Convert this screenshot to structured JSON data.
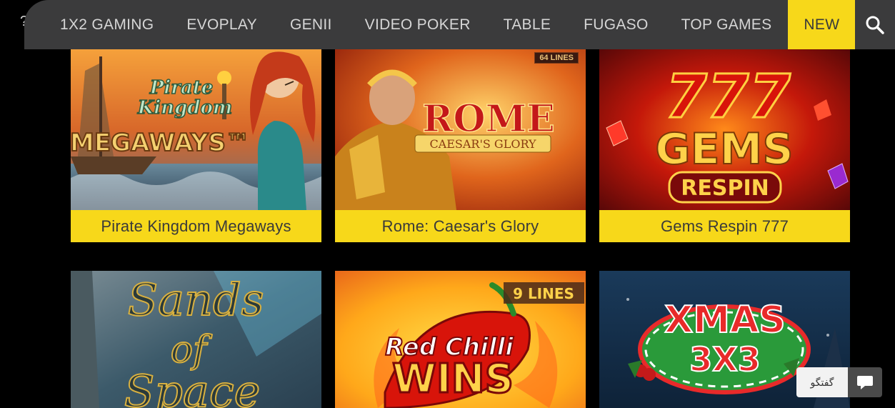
{
  "nav": {
    "items": [
      {
        "label": "1X2 GAMING",
        "active": false
      },
      {
        "label": "EVOPLAY",
        "active": false
      },
      {
        "label": "GENII",
        "active": false
      },
      {
        "label": "VIDEO POKER",
        "active": false
      },
      {
        "label": "TABLE",
        "active": false
      },
      {
        "label": "FUGASO",
        "active": false
      },
      {
        "label": "TOP GAMES",
        "active": false
      },
      {
        "label": "NEW",
        "active": true
      }
    ],
    "search_icon": "search-icon",
    "edge_glyph": "?"
  },
  "games": [
    {
      "caption": "Pirate Kingdom Megaways",
      "art": {
        "line1": "Pirate",
        "line2": "Kingdom",
        "line3": "MEGAWAYS™"
      }
    },
    {
      "caption": "Rome: Caesar's Glory",
      "art": {
        "line1": "ROME",
        "line2": "CAESAR'S GLORY",
        "badge": "64 LINES"
      }
    },
    {
      "caption": "Gems Respin 777",
      "art": {
        "line1": "777",
        "line2": "GEMS",
        "line3": "RESPIN"
      }
    },
    {
      "caption": "",
      "art": {
        "line1": "Sands",
        "line2": "of",
        "line3": "Space"
      }
    },
    {
      "caption": "",
      "art": {
        "line1": "Red Chilli",
        "line2": "WINS",
        "badge": "9 LINES"
      }
    },
    {
      "caption": "",
      "art": {
        "line1": "XMAS",
        "line2": "3X3"
      }
    }
  ],
  "chat": {
    "label": "گفتگو",
    "icon": "chat-bubble-icon"
  },
  "colors": {
    "nav_bg": "#3b3b3c",
    "accent": "#f7d81a",
    "page_bg": "#000000"
  }
}
